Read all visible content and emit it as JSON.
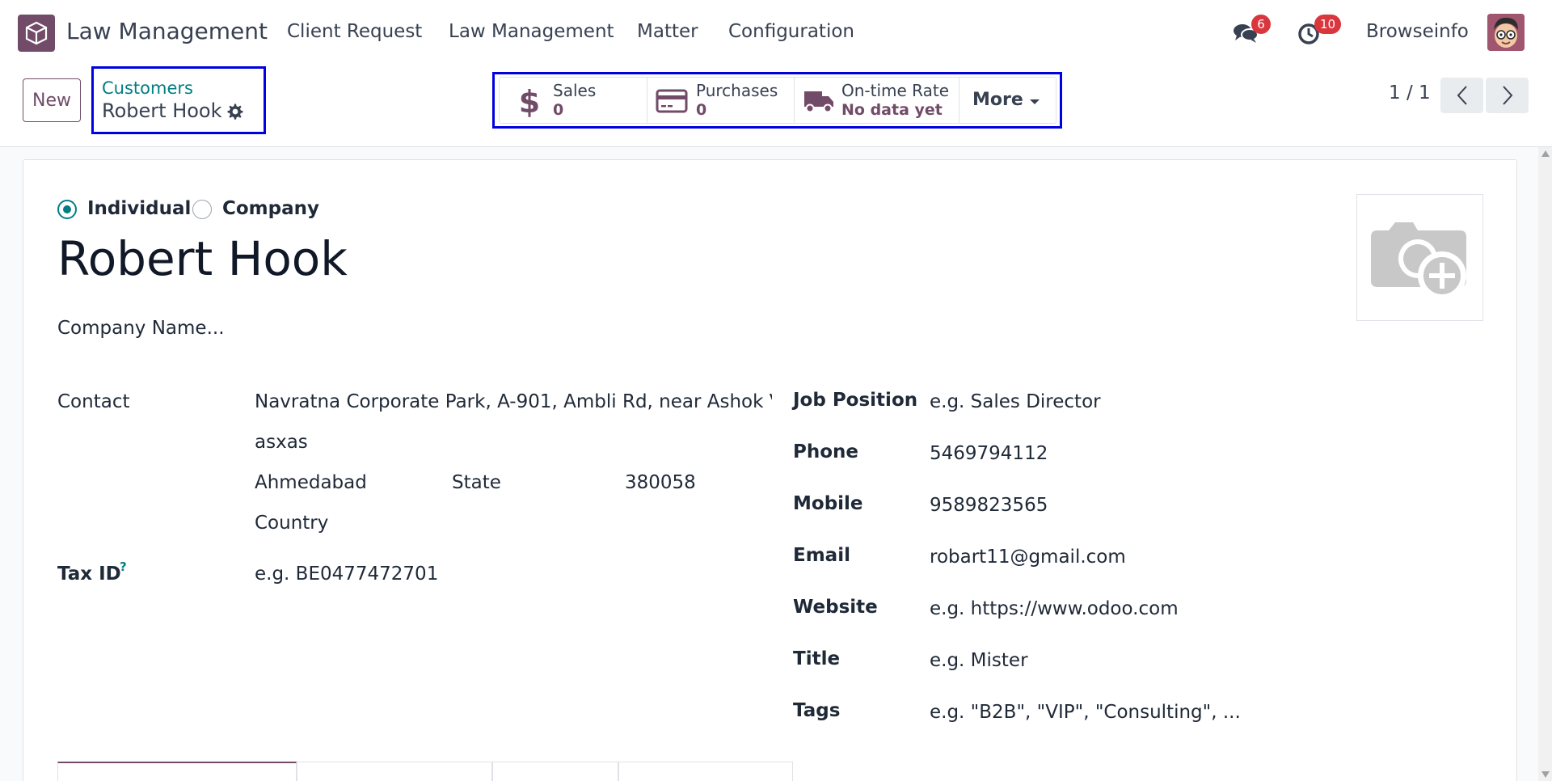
{
  "navbar": {
    "app_name": "Law Management",
    "menu": [
      "Client Request",
      "Law Management",
      "Matter",
      "Configuration"
    ],
    "messages_count": "6",
    "activities_count": "10",
    "user_name": "Browseinfo"
  },
  "control_panel": {
    "new_label": "New",
    "breadcrumb_parent": "Customers",
    "breadcrumb_current": "Robert Hook",
    "smart_buttons": [
      {
        "label": "Sales",
        "value": "0",
        "icon": "dollar-icon"
      },
      {
        "label": "Purchases",
        "value": "0",
        "icon": "credit-card-icon"
      },
      {
        "label": "On-time Rate",
        "value": "No data yet",
        "icon": "truck-icon"
      }
    ],
    "more_label": "More",
    "pager": "1 / 1"
  },
  "form": {
    "type_individual": "Individual",
    "type_company": "Company",
    "selected_type": "Individual",
    "name": "Robert Hook",
    "company_name_placeholder": "Company Name...",
    "contact_label": "Contact",
    "street": "Navratna Corporate Park, A-901, Ambli Rd, near Ashok V",
    "street2": "asxas",
    "city": "Ahmedabad",
    "state_placeholder": "State",
    "zip": "380058",
    "country_placeholder": "Country",
    "tax_id_label": "Tax ID",
    "tax_id_help": "?",
    "tax_id_placeholder": "e.g. BE0477472701",
    "job_position_label": "Job Position",
    "job_position_placeholder": "e.g. Sales Director",
    "phone_label": "Phone",
    "phone": "5469794112",
    "mobile_label": "Mobile",
    "mobile": "9589823565",
    "email_label": "Email",
    "email": "robart11@gmail.com",
    "website_label": "Website",
    "website_placeholder": "e.g. https://www.odoo.com",
    "title_label": "Title",
    "title_placeholder": "e.g. Mister",
    "tags_label": "Tags",
    "tags_placeholder": "e.g. \"B2B\", \"VIP\", \"Consulting\", ..."
  },
  "colors": {
    "brand": "#714b67",
    "accent": "#017e84",
    "badge": "#d9363e",
    "highlight_box": "#0000e0"
  }
}
